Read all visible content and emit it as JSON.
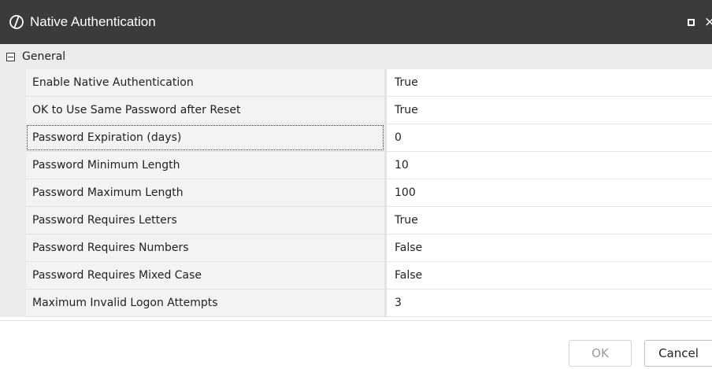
{
  "window": {
    "title": "Native Authentication",
    "logo_icon": "slashed-circle-logo",
    "maximize_icon": "maximize-icon",
    "close_icon": "close-icon",
    "close_glyph": "×"
  },
  "group": {
    "label": "General",
    "expanded": true,
    "expander_icon": "collapse-minus-icon"
  },
  "properties": [
    {
      "name": "Enable Native Authentication",
      "value": "True"
    },
    {
      "name": "OK to Use Same Password after Reset",
      "value": "True"
    },
    {
      "name": "Password Expiration (days)",
      "value": "0"
    },
    {
      "name": "Password Minimum Length",
      "value": "10"
    },
    {
      "name": "Password Maximum Length",
      "value": "100"
    },
    {
      "name": "Password Requires Letters",
      "value": "True"
    },
    {
      "name": "Password Requires Numbers",
      "value": "False"
    },
    {
      "name": "Password Requires Mixed Case",
      "value": "False"
    },
    {
      "name": "Maximum Invalid Logon Attempts",
      "value": "3"
    }
  ],
  "focused_property": "Password Expiration (days)",
  "buttons": {
    "ok_label": "OK",
    "ok_enabled": false,
    "cancel_label": "Cancel"
  },
  "colors": {
    "titlebar": "#3b3b3b",
    "group_background": "#ebebeb",
    "name_cell_background": "#f3f3f3"
  }
}
